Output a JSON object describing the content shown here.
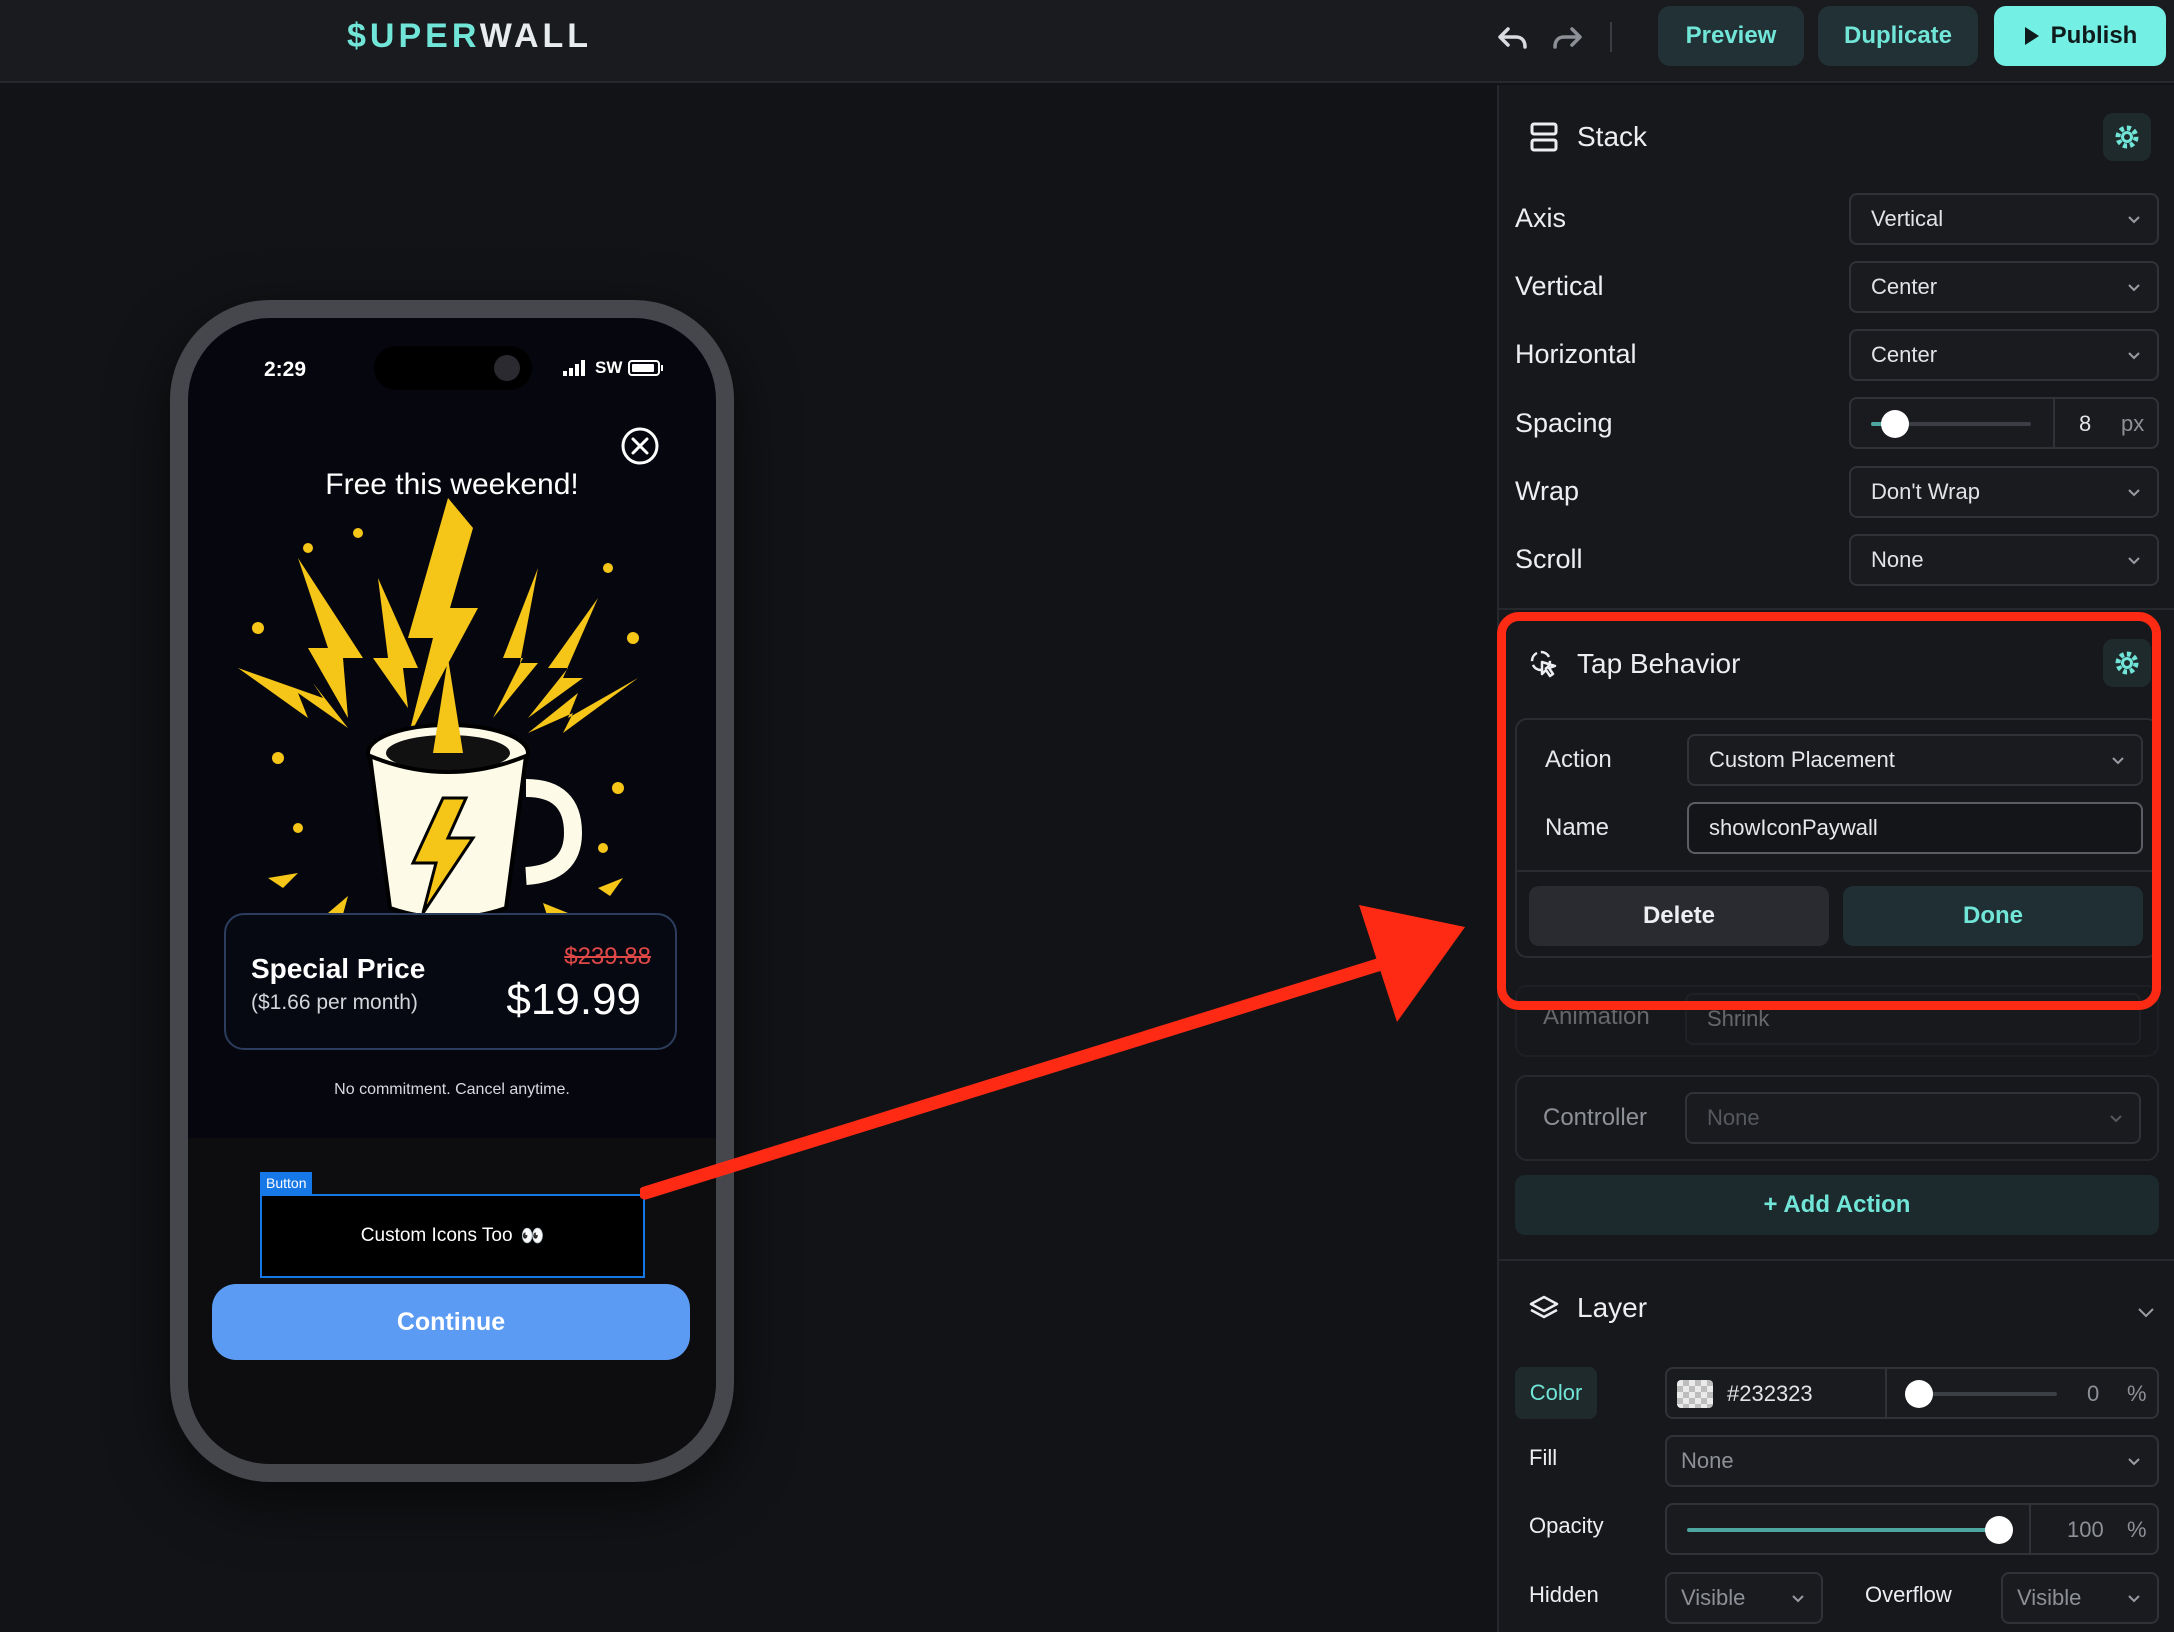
{
  "topbar": {
    "logo_prefix": "$UPER",
    "logo_suffix": "WALL",
    "preview_label": "Preview",
    "duplicate_label": "Duplicate",
    "publish_label": "Publish",
    "undo_icon": "undo-icon",
    "redo_icon": "redo-icon"
  },
  "phone": {
    "time": "2:29",
    "carrier": "SW",
    "headline": "Free this weekend!",
    "price_card": {
      "title": "Special Price",
      "subtitle": "($1.66 per month)",
      "old_price": "$239.88",
      "new_price": "$19.99"
    },
    "no_commitment": "No commitment. Cancel anytime.",
    "selection_tag": "Button",
    "selected_button": "Custom Icons Too",
    "selected_button_emoji": "👀",
    "continue_label": "Continue"
  },
  "panel": {
    "stack": {
      "title": "Stack",
      "rows": [
        {
          "label": "Axis",
          "value": "Vertical"
        },
        {
          "label": "Vertical",
          "value": "Center"
        },
        {
          "label": "Horizontal",
          "value": "Center"
        },
        {
          "label": "Spacing",
          "value": "8",
          "unit": "px"
        },
        {
          "label": "Wrap",
          "value": "Don't Wrap"
        },
        {
          "label": "Scroll",
          "value": "None"
        }
      ]
    },
    "tap_behavior": {
      "title": "Tap Behavior",
      "action_label": "Action",
      "action_value": "Custom Placement",
      "name_label": "Name",
      "name_value": "showIconPaywall",
      "delete_label": "Delete",
      "done_label": "Done",
      "animation_label": "Animation",
      "animation_value": "Shrink",
      "controller_label": "Controller",
      "controller_value": "None",
      "add_action_label": "+ Add Action"
    },
    "layer": {
      "title": "Layer",
      "color_label": "Color",
      "color_value": "#232323",
      "color_alpha": "0",
      "color_alpha_unit": "%",
      "fill_label": "Fill",
      "fill_value": "None",
      "opacity_label": "Opacity",
      "opacity_value": "100",
      "opacity_unit": "%",
      "hidden_label": "Hidden",
      "hidden_value": "Visible",
      "overflow_label": "Overflow",
      "overflow_value": "Visible"
    }
  },
  "colors": {
    "accent": "#71e6d8",
    "highlight": "#ff2a14",
    "selection": "#1677e6",
    "continue": "#5c9bf3"
  }
}
